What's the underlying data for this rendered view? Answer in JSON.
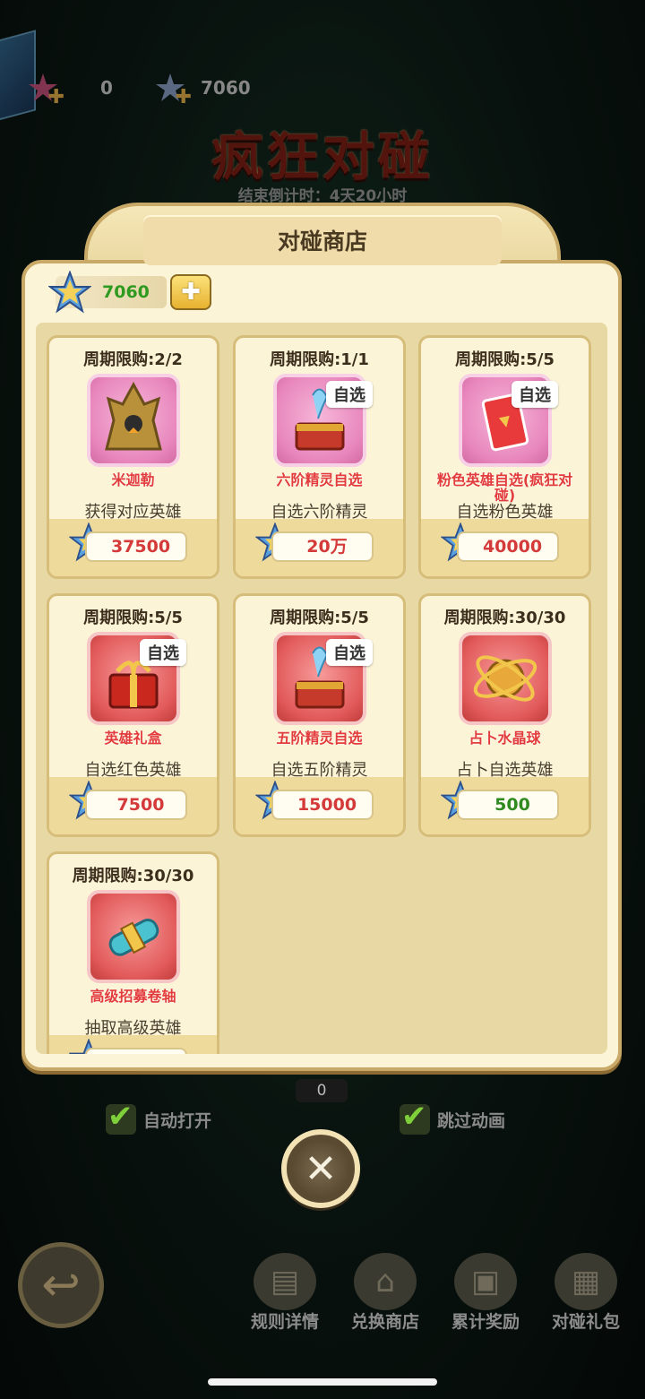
{
  "top_bar": {
    "resource1_value": "0",
    "resource2_value": "7060"
  },
  "event": {
    "title": "疯狂对碰",
    "countdown": "结束倒计时：4天20小时"
  },
  "shop": {
    "title": "对碰商店",
    "currency_value": "7060",
    "items": [
      {
        "limit": "周期限购:2/2",
        "name": "米迦勒",
        "desc": "获得对应英雄",
        "price": "37500",
        "self_select": "",
        "icon": "hero-portrait-icon",
        "frame": "gold",
        "price_color": "red"
      },
      {
        "limit": "周期限购:1/1",
        "name": "六阶精灵自选",
        "desc": "自选六阶精灵",
        "price": "20万",
        "self_select": "自选",
        "icon": "spirit-chest-icon",
        "frame": "gold",
        "price_color": "red"
      },
      {
        "limit": "周期限购:5/5",
        "name": "粉色英雄自选(疯狂对碰)",
        "desc": "自选粉色英雄",
        "price": "40000",
        "self_select": "自选",
        "icon": "pink-card-icon",
        "frame": "gold",
        "price_color": "red"
      },
      {
        "limit": "周期限购:5/5",
        "name": "英雄礼盒",
        "desc": "自选红色英雄",
        "price": "7500",
        "self_select": "自选",
        "icon": "gift-box-icon",
        "frame": "red",
        "price_color": "red"
      },
      {
        "limit": "周期限购:5/5",
        "name": "五阶精灵自选",
        "desc": "自选五阶精灵",
        "price": "15000",
        "self_select": "自选",
        "icon": "spirit-chest-icon",
        "frame": "red",
        "price_color": "red"
      },
      {
        "limit": "周期限购:30/30",
        "name": "占卜水晶球",
        "desc": "占卜自选英雄",
        "price": "500",
        "self_select": "",
        "icon": "crystal-ball-icon",
        "frame": "red",
        "price_color": "green"
      },
      {
        "limit": "周期限购:30/30",
        "name": "高级招募卷轴",
        "desc": "抽取高级英雄",
        "price": "",
        "self_select": "",
        "icon": "scroll-icon",
        "frame": "red",
        "price_color": "red"
      }
    ]
  },
  "bottom": {
    "counter": "0",
    "auto_open_label": "自动打开",
    "skip_anim_label": "跳过动画",
    "nav": [
      {
        "label": "规则详情",
        "icon": "document-icon"
      },
      {
        "label": "兑换商店",
        "icon": "shop-icon"
      },
      {
        "label": "累计奖励",
        "icon": "gift-icon"
      },
      {
        "label": "对碰礼包",
        "icon": "package-icon"
      }
    ]
  }
}
